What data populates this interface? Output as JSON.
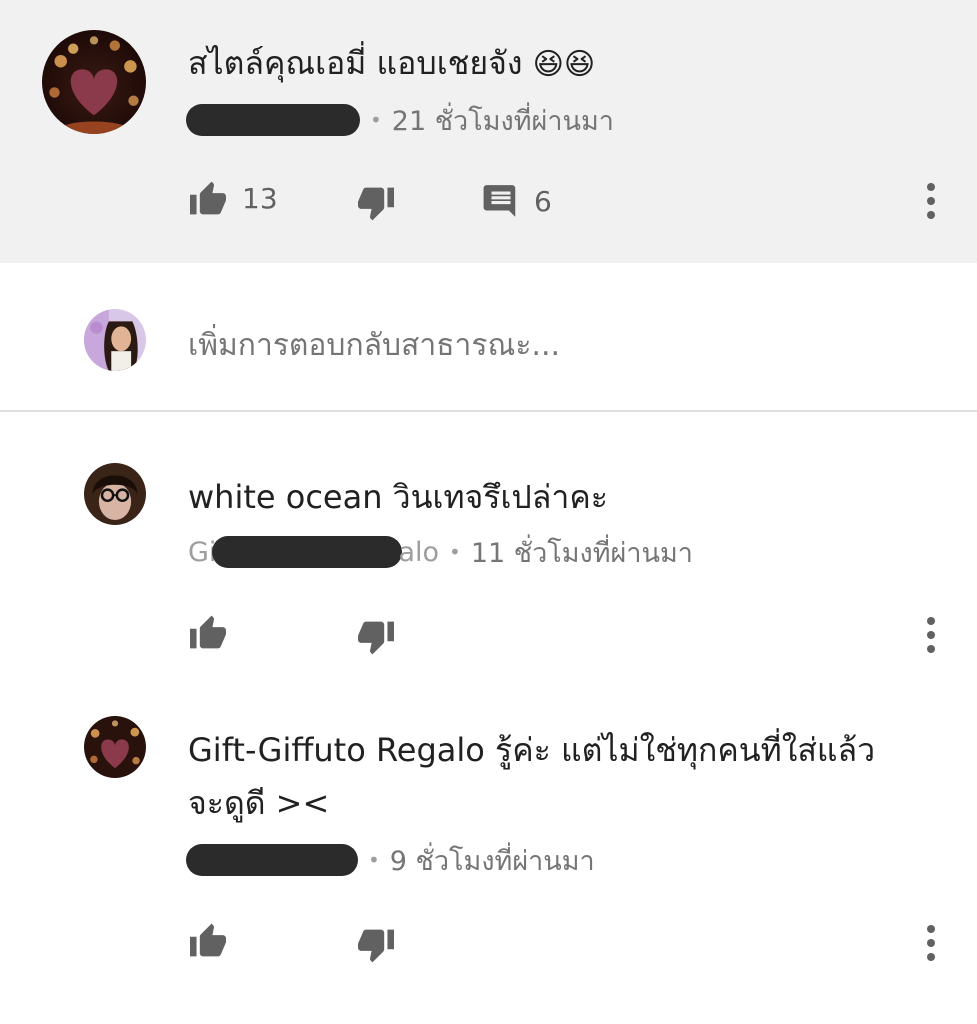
{
  "main_comment": {
    "text": "สไตล์คุณเอมี่ แอบเชยจัง",
    "emoji": "😆😆",
    "time": "21 ชั่วโมงที่ผ่านมา",
    "likes": "13",
    "replies": "6"
  },
  "reply_box": {
    "placeholder": "เพิ่มการตอบกลับสาธารณะ..."
  },
  "replies": [
    {
      "text": "white ocean วินเทจรึเปล่าคะ",
      "author_prefix": "Gi",
      "author_suffix": "alo",
      "time": "11 ชั่วโมงที่ผ่านมา"
    },
    {
      "text_line1": "Gift-Giffuto Regalo รู้ค่ะ แต่ไม่ใช่ทุกคนที่ใส่แล้ว",
      "text_line2": "จะดูดี ><",
      "time": "9 ชั่วโมงที่ผ่านมา"
    }
  ],
  "icons": {
    "like": "thumb-up-icon",
    "dislike": "thumb-down-icon",
    "reply": "comment-icon",
    "more": "more-vertical-icon"
  }
}
